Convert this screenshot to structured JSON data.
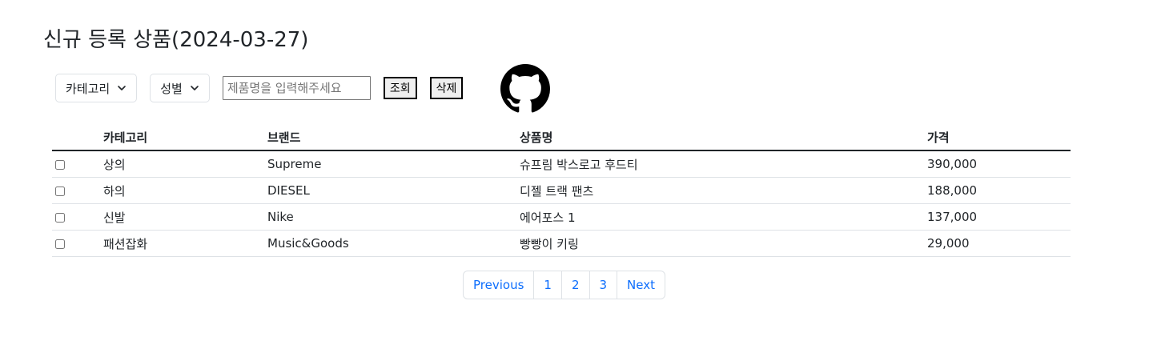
{
  "page": {
    "title": "신규 등록 상품(2024-03-27)"
  },
  "toolbar": {
    "category_dropdown_label": "카테고리",
    "gender_dropdown_label": "성별",
    "search_placeholder": "제품명을 입력해주세요",
    "search_value": "",
    "search_button_label": "조회",
    "delete_button_label": "삭제",
    "github_icon": "github-icon"
  },
  "table": {
    "headers": {
      "category": "카테고리",
      "brand": "브랜드",
      "name": "상품명",
      "price": "가격"
    },
    "rows": [
      {
        "checked": false,
        "category": "상의",
        "brand": "Supreme",
        "name": "슈프림 박스로고 후드티",
        "price": "390,000"
      },
      {
        "checked": false,
        "category": "하의",
        "brand": "DIESEL",
        "name": "디젤 트랙 팬츠",
        "price": "188,000"
      },
      {
        "checked": false,
        "category": "신발",
        "brand": "Nike",
        "name": "에어포스 1",
        "price": "137,000"
      },
      {
        "checked": false,
        "category": "패션잡화",
        "brand": "Music&Goods",
        "name": "빵빵이 키링",
        "price": "29,000"
      }
    ]
  },
  "pagination": {
    "previous_label": "Previous",
    "pages": [
      "1",
      "2",
      "3"
    ],
    "next_label": "Next"
  },
  "colors": {
    "link": "#0d6efd",
    "border": "#dee2e6",
    "text": "#212529"
  }
}
